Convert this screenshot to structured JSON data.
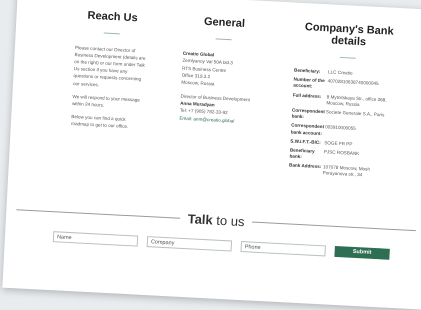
{
  "reach_us": {
    "title": "Reach Us",
    "paragraphs": [
      "Please contact our Director of Business Development (details are on the right) or our form under Talk Us section if you have any questions or requests concerning our services.",
      "We will respond to your message within 24 hours.",
      "Below you can find a quick roadmap to get to our office."
    ]
  },
  "general": {
    "title": "General",
    "company": "Creatio Global",
    "address_lines": [
      "Zemlyanoy Val 50A bld.3",
      "RTS Business Centre",
      "Office 319.3.2",
      "Moscow, Russia"
    ],
    "role": "Director of Business Development",
    "person": "Anna Muradyan",
    "phone": "Tel: +7 (905) 782-33-92",
    "email": "Email: anm@creatio.global"
  },
  "bank": {
    "title": "Company's Bank details",
    "rows": [
      {
        "label": "Beneficiary:",
        "value": "LLC Creatio"
      },
      {
        "label": "Number of the account:",
        "value": "40702810638740000045"
      },
      {
        "label": "Full address:",
        "value": "8 Mytnitskaya Str., office 368, Moscow, Russia"
      },
      {
        "label": "Correspondent bank:",
        "value": "Societe Generale S.A., Paris"
      },
      {
        "label": "Correspondent bank account:",
        "value": "003910000055"
      },
      {
        "label": "S.W.I.F.T.-BIC:",
        "value": "SOGE FR PP"
      },
      {
        "label": "Beneficiary bank:",
        "value": "PJSC ROSBANK"
      },
      {
        "label": "Bank Address:",
        "value": "107078 Moscow, Mosh Porayanova str., 34"
      }
    ]
  },
  "talk": {
    "bold": "Talk",
    "rest": "to us"
  },
  "form": {
    "name_placeholder": "Name",
    "company_placeholder": "Company",
    "phone_placeholder": "Phone",
    "submit_label": "Submit"
  }
}
